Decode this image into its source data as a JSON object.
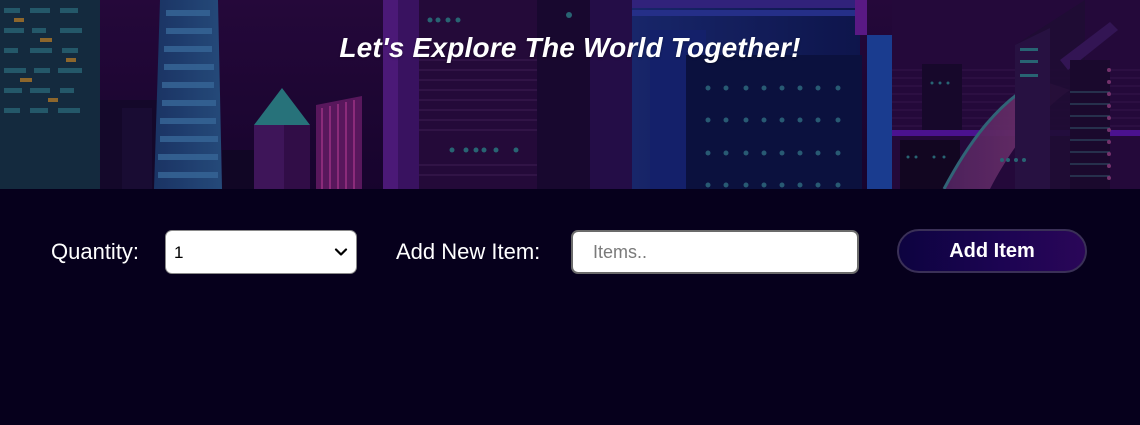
{
  "hero": {
    "title": "Let's Explore The World Together!",
    "image_icon": "city-skyline-illustration",
    "colors": {
      "sky": "#2a0a3f",
      "building_dark": "#1a0a35",
      "building_purple": "#4b1570",
      "accent_teal": "#2f7a86",
      "accent_blue": "#1d3f8f"
    }
  },
  "form": {
    "quantity_label": "Quantity:",
    "quantity_selected": "1",
    "quantity_options": [
      "1"
    ],
    "add_item_label": "Add New Item:",
    "item_input_placeholder": "Items..",
    "item_input_value": "",
    "add_button_label": "Add Item"
  },
  "colors": {
    "page_background": "#06001c",
    "button_gradient_start": "#0d0340",
    "button_gradient_end": "#2a0658",
    "text": "#ffffff"
  }
}
